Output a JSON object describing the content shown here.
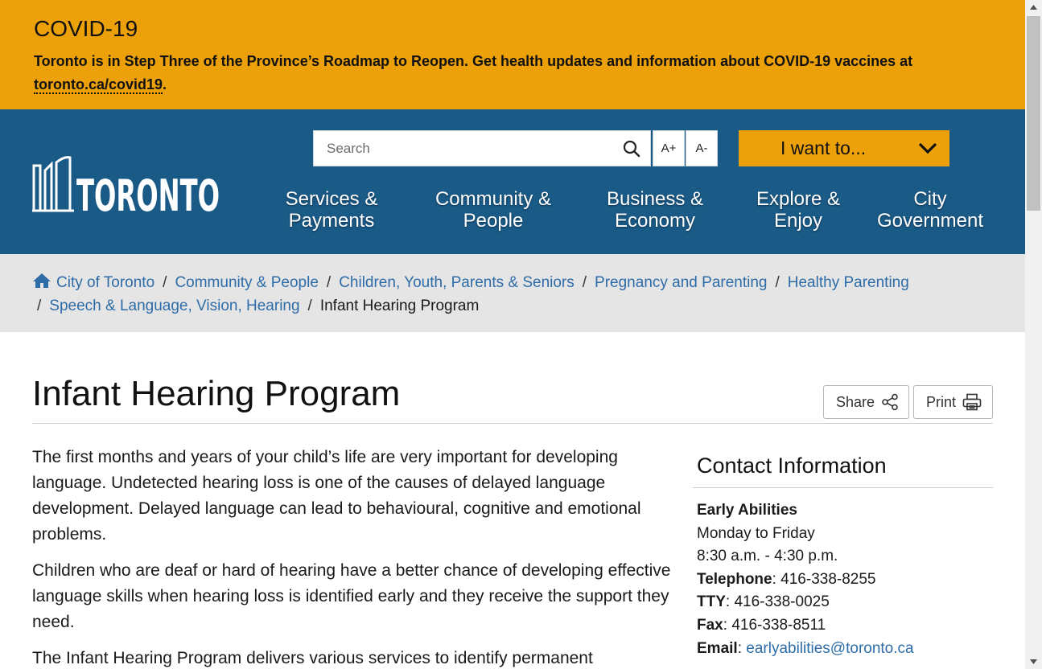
{
  "colors": {
    "banner": "#ECA10B",
    "header": "#1A5A87",
    "link": "#2E6CA8",
    "crumb_bg": "#E5E5E5"
  },
  "covid": {
    "heading": "COVID-19",
    "text": "Toronto is in Step Three of the Province’s Roadmap to Reopen.  Get health updates and information about COVID-19 vaccines at ",
    "link": "toronto.ca/covid19",
    "end": "."
  },
  "header": {
    "logo_text": "TORONTO",
    "search_placeholder": "Search",
    "font_increase": "A+",
    "font_decrease": "A-",
    "i_want_to": "I want to...",
    "nav": [
      {
        "line1": "Services &",
        "line2": "Payments"
      },
      {
        "line1": "Community &",
        "line2": "People"
      },
      {
        "line1": "Business &",
        "line2": "Economy"
      },
      {
        "line1": "Explore &",
        "line2": "Enjoy"
      },
      {
        "line1": "City",
        "line2": "Government"
      }
    ]
  },
  "breadcrumb": {
    "items": [
      "City of Toronto",
      "Community & People",
      "Children, Youth, Parents & Seniors",
      "Pregnancy and Parenting",
      "Healthy Parenting",
      "Speech & Language, Vision, Hearing"
    ],
    "current": "Infant Hearing Program"
  },
  "page": {
    "title": "Infant Hearing Program",
    "share_label": "Share",
    "print_label": "Print",
    "paragraphs": [
      "The first months and years of your child’s life are very important for developing language. Undetected hearing loss is one of the causes of delayed language development. Delayed language can lead to behavioural, cognitive and emotional problems.",
      "Children who are deaf or hard of hearing have a better chance of developing effective language skills when hearing loss is identified early and they receive the support they need.",
      "The Infant Hearing Program delivers various services to identify permanent"
    ]
  },
  "contact": {
    "heading": "Contact Information",
    "org": "Early Abilities",
    "days": "Monday to Friday",
    "hours": "8:30 a.m. - 4:30 p.m.",
    "telephone_label": "Telephone",
    "telephone": "416-338-8255",
    "tty_label": "TTY",
    "tty": "416-338-0025",
    "fax_label": "Fax",
    "fax": "416-338-8511",
    "email_label": "Email",
    "email": "earlyabilities@toronto.ca"
  }
}
